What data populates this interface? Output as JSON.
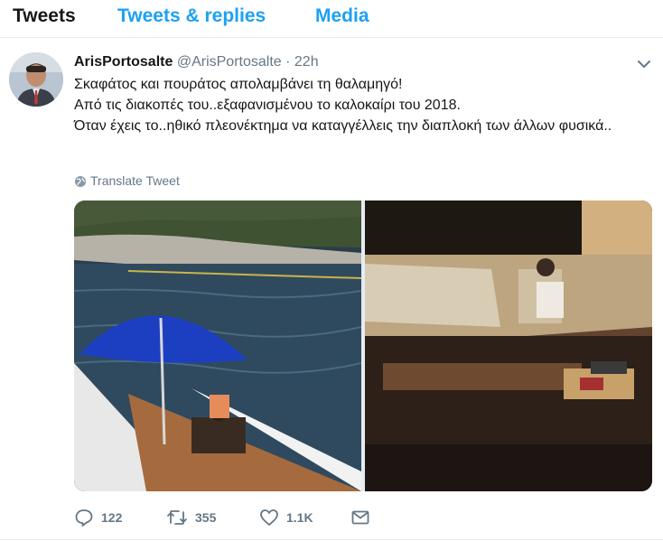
{
  "tabs": [
    {
      "label": "Tweets",
      "active": true
    },
    {
      "label": "Tweets & replies",
      "active": false
    },
    {
      "label": "Media",
      "active": false
    }
  ],
  "tweet": {
    "display_name": "ArisPortosalte",
    "handle": "@ArisPortosalte",
    "separator": "·",
    "time": "22h",
    "lines": [
      "Σκαφάτος και πουράτος απολαμβάνει τη θαλαμηγό!",
      "Από τις διακοπές του..εξαφανισμένου το καλοκαίρι του 2018.",
      "Όταν έχεις το..ηθικό πλεονέκτημα να καταγγέλλεις την διαπλοκή των άλλων φυσικά.."
    ],
    "translate_label": "Translate Tweet",
    "media": [
      {
        "description_icon": "photo-yacht-deck"
      },
      {
        "description_icon": "photo-yacht-cabin"
      }
    ]
  },
  "actions": {
    "reply_count": "122",
    "retweet_count": "355",
    "like_count": "1.1K"
  },
  "colors": {
    "accent": "#1da1f2",
    "muted": "#657786",
    "text": "#14171a",
    "divider": "#e6ecf0"
  },
  "icons": {
    "reply": "reply-icon",
    "retweet": "retweet-icon",
    "like": "heart-icon",
    "dm": "envelope-icon",
    "caret": "chevron-down-icon",
    "globe": "globe-icon"
  }
}
